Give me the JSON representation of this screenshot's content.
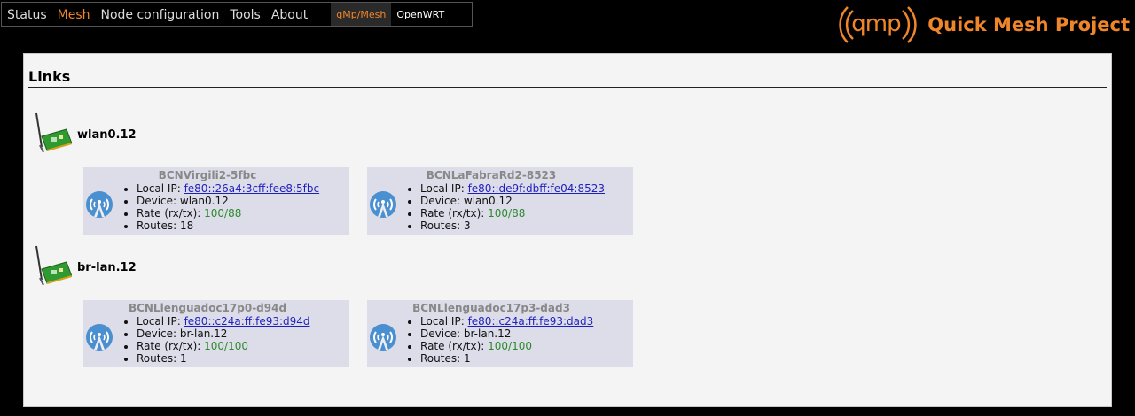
{
  "nav": {
    "menu": [
      {
        "label": "Status",
        "active": false
      },
      {
        "label": "Mesh",
        "active": true
      },
      {
        "label": "Node configuration",
        "active": false
      },
      {
        "label": "Tools",
        "active": false
      },
      {
        "label": "About",
        "active": false
      }
    ],
    "sub": [
      {
        "label": "qMp/Mesh",
        "active": true
      },
      {
        "label": "OpenWRT",
        "active": false
      }
    ]
  },
  "logo": {
    "mark": "qmp",
    "title": "Quick Mesh Project"
  },
  "main": {
    "title": "Links",
    "interfaces": [
      {
        "name": "wlan0.12",
        "links": [
          {
            "node": "BCNVirgili2-5fbc",
            "local_ip_label": "Local IP: ",
            "local_ip": "fe80::26a4:3cff:fee8:5fbc",
            "device": "Device: wlan0.12",
            "rate_label": "Rate (rx/tx): ",
            "rate": "100/88",
            "routes": "Routes: 18"
          },
          {
            "node": "BCNLaFabraRd2-8523",
            "local_ip_label": "Local IP: ",
            "local_ip": "fe80::de9f:dbff:fe04:8523",
            "device": "Device: wlan0.12",
            "rate_label": "Rate (rx/tx): ",
            "rate": "100/88",
            "routes": "Routes: 3"
          }
        ]
      },
      {
        "name": "br-lan.12",
        "links": [
          {
            "node": "BCNLlenguadoc17p0-d94d",
            "local_ip_label": "Local IP: ",
            "local_ip": "fe80::c24a:ff:fe93:d94d",
            "device": "Device: br-lan.12",
            "rate_label": "Rate (rx/tx): ",
            "rate": "100/100",
            "routes": "Routes: 1"
          },
          {
            "node": "BCNLlenguadoc17p3-dad3",
            "local_ip_label": "Local IP: ",
            "local_ip": "fe80::c24a:ff:fe93:dad3",
            "device": "Device: br-lan.12",
            "rate_label": "Rate (rx/tx): ",
            "rate": "100/100",
            "routes": "Routes: 1"
          }
        ]
      }
    ]
  },
  "colors": {
    "accent": "#f0862a",
    "card_bg": "#dcdde9",
    "link": "#1f1fbe",
    "rate": "#2b8a2b"
  }
}
